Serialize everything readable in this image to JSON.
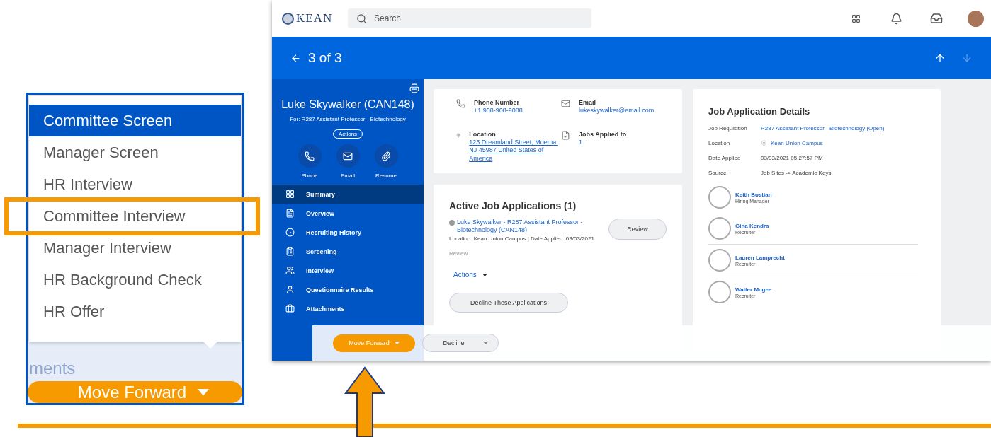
{
  "inset": {
    "menu_items": [
      {
        "label": "Committee Screen",
        "selected": true,
        "highlighted": false
      },
      {
        "label": "Manager Screen",
        "selected": false,
        "highlighted": false
      },
      {
        "label": "HR Interview",
        "selected": false,
        "highlighted": false
      },
      {
        "label": "Committee Interview",
        "selected": false,
        "highlighted": true
      },
      {
        "label": "Manager Interview",
        "selected": false,
        "highlighted": false
      },
      {
        "label": "HR Background Check",
        "selected": false,
        "highlighted": false
      },
      {
        "label": "HR Offer",
        "selected": false,
        "highlighted": false
      }
    ],
    "background_text": "ments",
    "button": "Move Forward"
  },
  "app": {
    "logo": "KEAN",
    "search": {
      "placeholder": "Search"
    },
    "pager": "3 of 3",
    "candidate": {
      "name": "Luke Skywalker (CAN148)",
      "for": "For: R287 Assistant Professor - Biotechnology",
      "actions": "Actions",
      "quick_actions": [
        {
          "label": "Phone"
        },
        {
          "label": "Email"
        },
        {
          "label": "Resume"
        }
      ]
    },
    "nav": [
      {
        "label": "Summary",
        "selected": true
      },
      {
        "label": "Overview",
        "selected": false
      },
      {
        "label": "Recruiting History",
        "selected": false
      },
      {
        "label": "Screening",
        "selected": false
      },
      {
        "label": "Interview",
        "selected": false
      },
      {
        "label": "Questionnaire Results",
        "selected": false
      },
      {
        "label": "Attachments",
        "selected": false
      }
    ],
    "contact": [
      {
        "label": "Phone Number",
        "value": "+1 908-908-9088",
        "underlined": false
      },
      {
        "label": "Email",
        "value": "lukeskywalker@email.com",
        "underlined": false
      },
      {
        "label": "Location",
        "value": "123 Dreamland Street, Moema, NJ 45987 United States of America",
        "underlined": true
      },
      {
        "label": "Jobs Applied to",
        "value": "1",
        "underlined": false
      }
    ],
    "active_applications": {
      "title": "Active Job Applications (1)",
      "application": "Luke Skywalker - R287 Assistant Professor - Biotechnology (CAN148)",
      "meta": "Location: Kean Union Campus | Date Applied: 03/03/2021",
      "status": "Review",
      "review_button": "Review",
      "actions": "Actions",
      "decline_button": "Decline These Applications"
    },
    "details": {
      "title": "Job Application Details",
      "rows": [
        {
          "label": "Job Requisition",
          "value": "R287 Assistant Professor - Biotechnology (Open)",
          "kind": "link"
        },
        {
          "label": "Location",
          "value": "Kean Union Campus",
          "kind": "place"
        },
        {
          "label": "Date Applied",
          "value": "03/03/2021 05:27:57 PM",
          "kind": "text"
        },
        {
          "label": "Source",
          "value": "Job Sites -> Academic Keys",
          "kind": "text"
        }
      ],
      "people": [
        {
          "name": "Keith Bostian",
          "role": "Hiring Manager"
        },
        {
          "name": "Gina Kendra",
          "role": "Recruiter"
        },
        {
          "name": "Lauren Lamprecht",
          "role": "Recruiter"
        },
        {
          "name": "Walter Mcgee",
          "role": "Recruiter"
        }
      ]
    },
    "action_bar": {
      "move_forward": "Move Forward",
      "decline": "Decline"
    }
  }
}
